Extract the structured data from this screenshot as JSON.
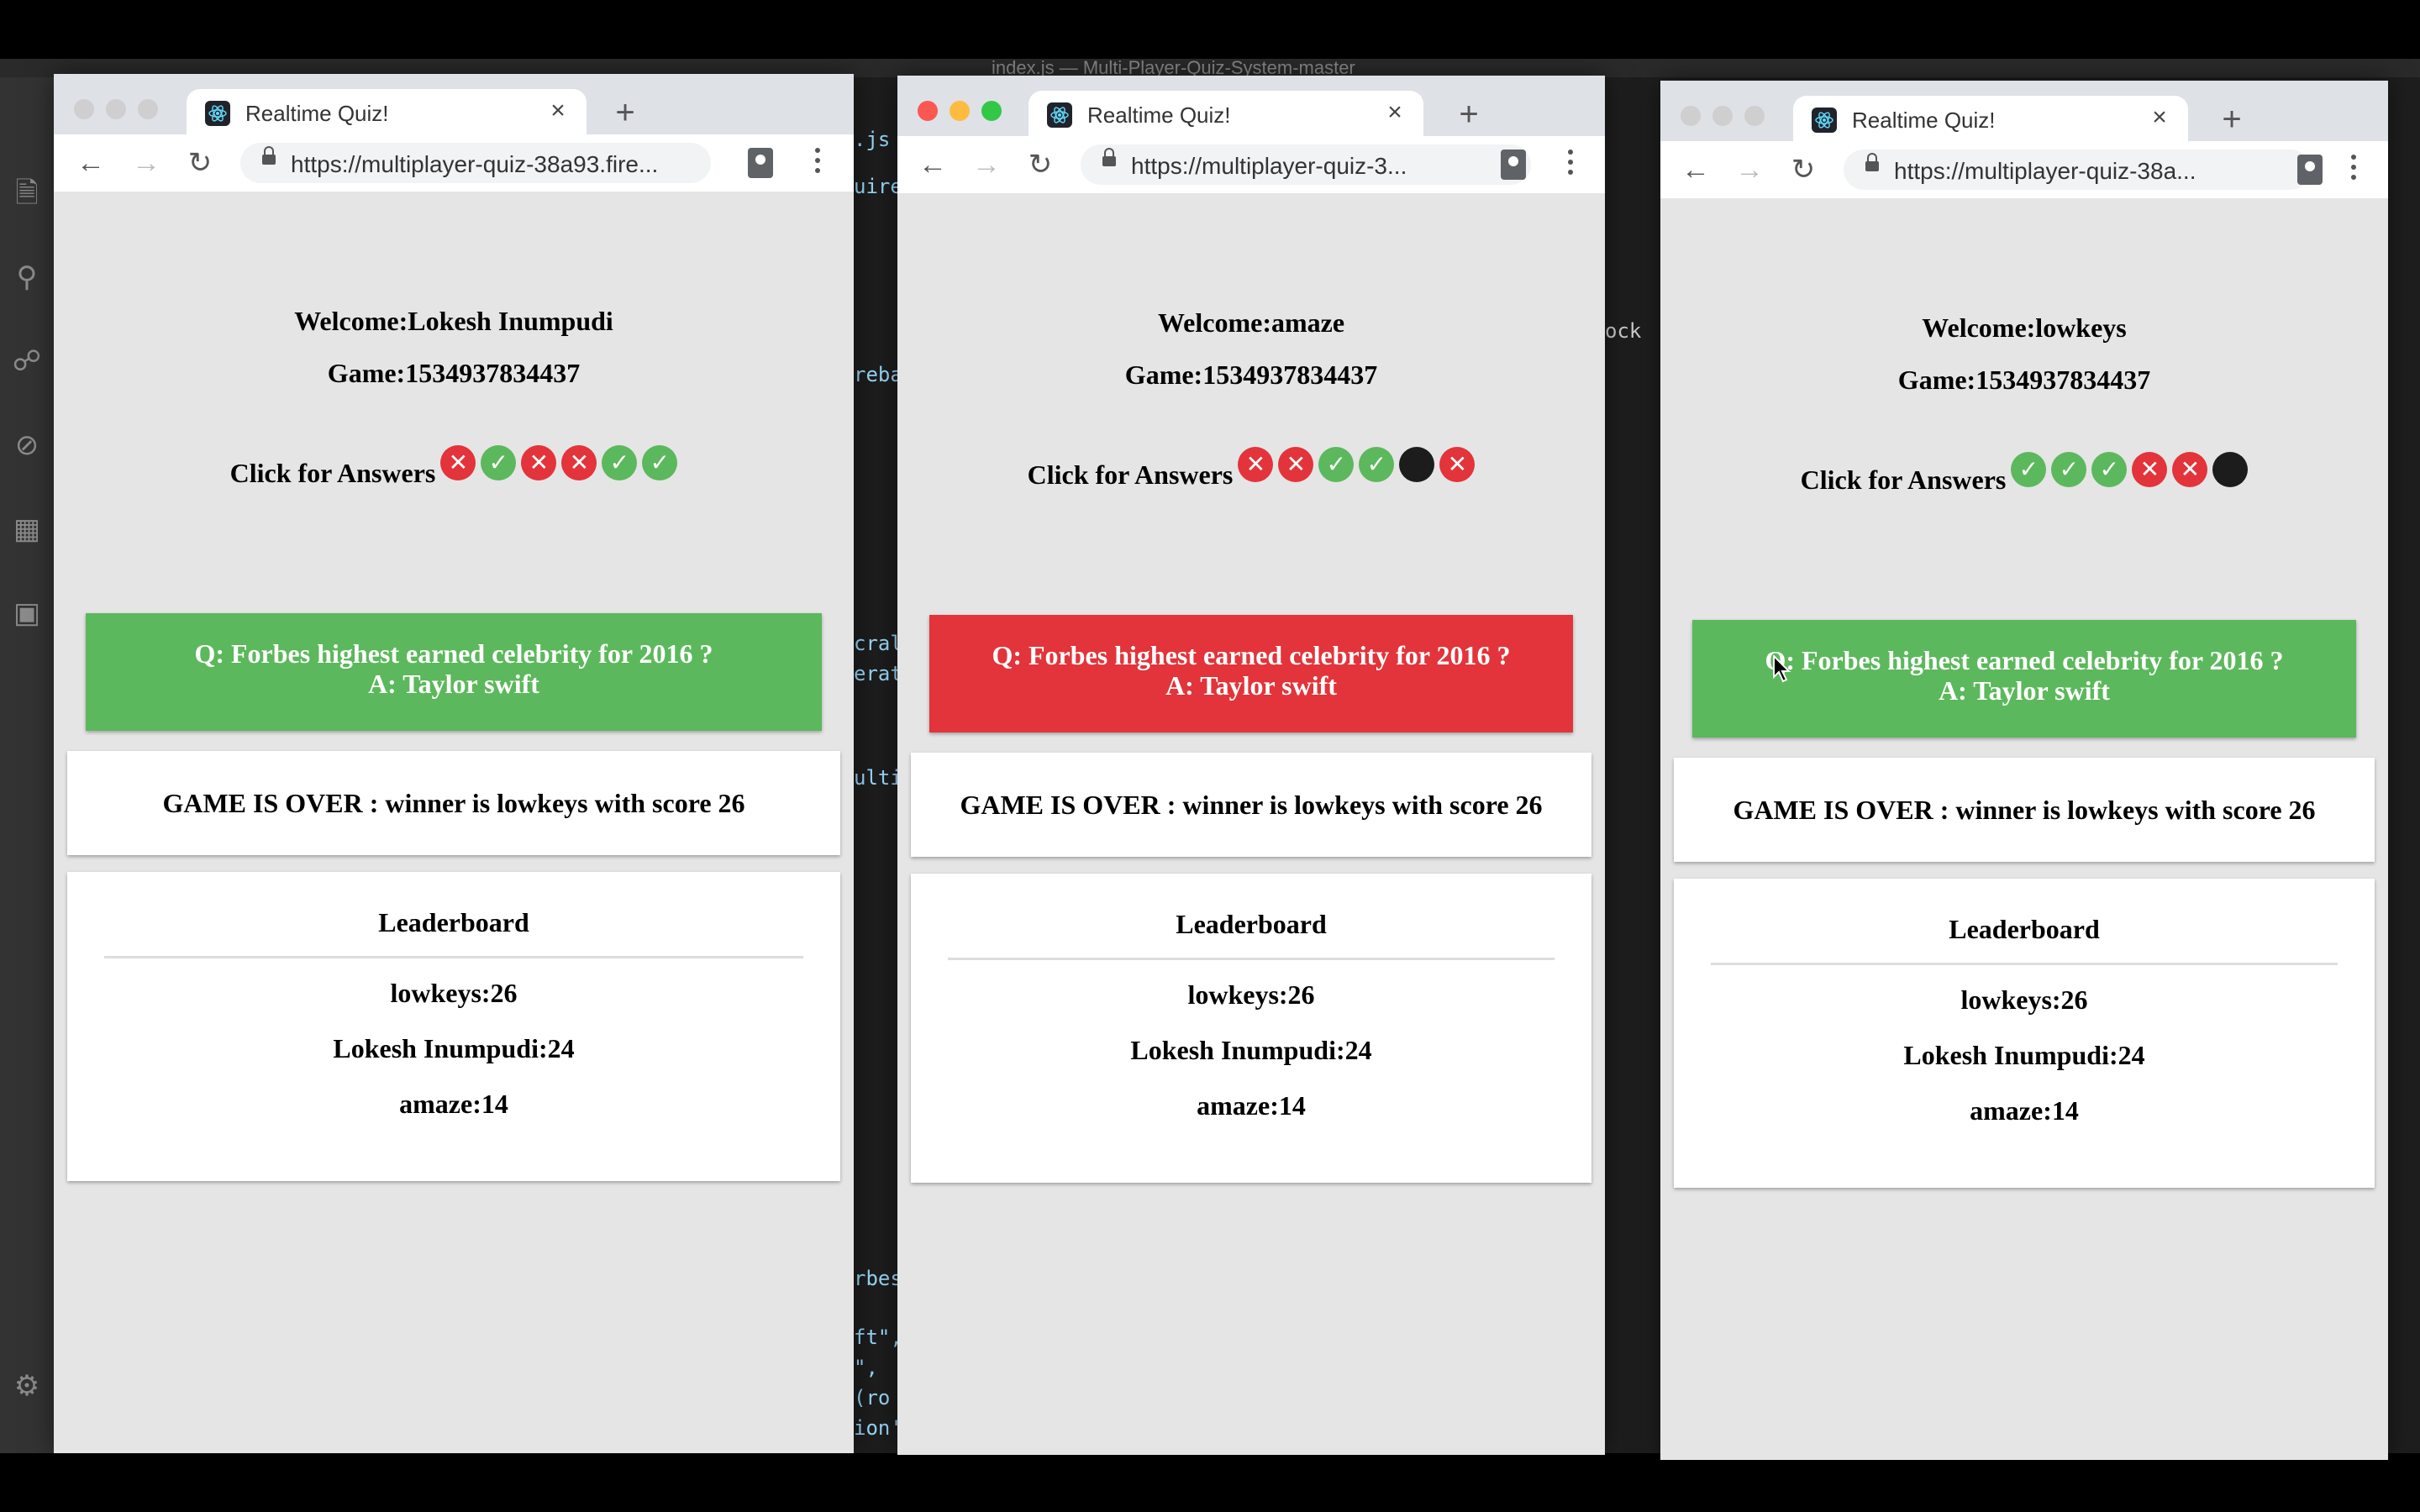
{
  "editor": {
    "title_fragment": "index.js — Multi-Player-Quiz-System-master",
    "fragments": [
      ".js",
      "uire",
      "reba",
      "cral",
      "erat",
      "ulti",
      "rbes",
      "ft\",",
      "\",",
      "(ro",
      "ion'",
      "ock"
    ]
  },
  "windows": [
    {
      "active": false,
      "tab_title": "Realtime Quiz!",
      "url": "https://multiplayer-quiz-38a93.fire...",
      "welcome": "Welcome:Lokesh Inumpudi",
      "game": "Game:1534937834437",
      "answers_label": "Click for Answers",
      "answers": [
        "wrong",
        "correct",
        "wrong",
        "wrong",
        "correct",
        "correct"
      ],
      "question": "Q: Forbes highest earned celebrity for 2016 ?",
      "answer": "A: Taylor swift",
      "question_status": "correct",
      "game_over": "GAME IS OVER : winner is lowkeys with score 26",
      "leaderboard_title": "Leaderboard",
      "leaderboard": [
        "lowkeys:26",
        "Lokesh Inumpudi:24",
        "amaze:14"
      ]
    },
    {
      "active": true,
      "tab_title": "Realtime Quiz!",
      "url": "https://multiplayer-quiz-3...",
      "welcome": "Welcome:amaze",
      "game": "Game:1534937834437",
      "answers_label": "Click for Answers",
      "answers": [
        "wrong",
        "wrong",
        "correct",
        "correct",
        "pending",
        "wrong"
      ],
      "question": "Q: Forbes highest earned celebrity for 2016 ?",
      "answer": "A: Taylor swift",
      "question_status": "wrong",
      "game_over": "GAME IS OVER : winner is lowkeys with score 26",
      "leaderboard_title": "Leaderboard",
      "leaderboard": [
        "lowkeys:26",
        "Lokesh Inumpudi:24",
        "amaze:14"
      ]
    },
    {
      "active": false,
      "tab_title": "Realtime Quiz!",
      "url": "https://multiplayer-quiz-38a...",
      "welcome": "Welcome:lowkeys",
      "game": "Game:1534937834437",
      "answers_label": "Click for Answers",
      "answers": [
        "correct",
        "correct",
        "correct",
        "wrong",
        "wrong",
        "pending"
      ],
      "question": "Q: Forbes highest earned celebrity for 2016 ?",
      "answer": "A: Taylor swift",
      "question_status": "correct",
      "game_over": "GAME IS OVER : winner is lowkeys with score 26",
      "leaderboard_title": "Leaderboard",
      "leaderboard": [
        "lowkeys:26",
        "Lokesh Inumpudi:24",
        "amaze:14"
      ]
    }
  ],
  "colors": {
    "correct": "#5cb85c",
    "wrong": "#e2343a",
    "pending": "#1c1c1c"
  }
}
